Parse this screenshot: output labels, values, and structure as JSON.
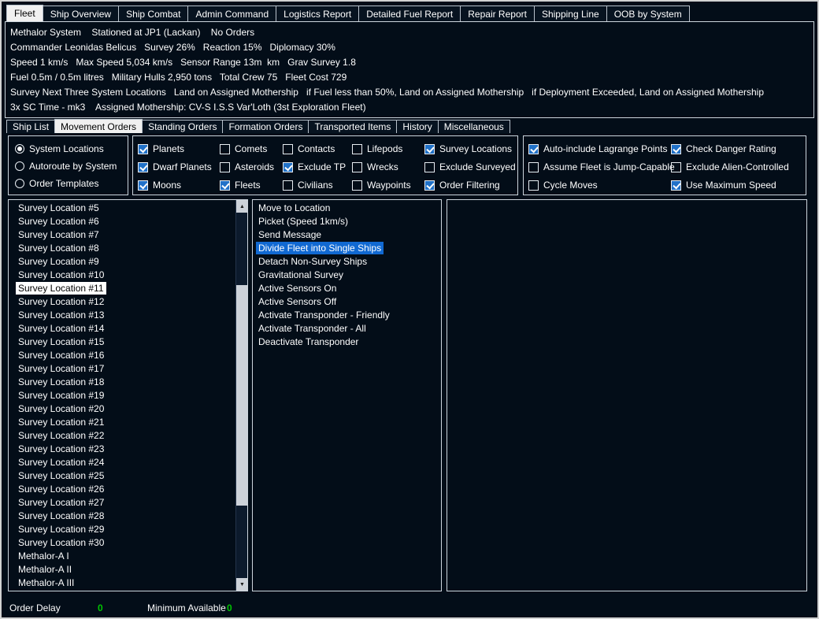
{
  "window": {
    "bg": "#030d18",
    "selection_blue": "#1169d2",
    "selection_white": "#ffffff",
    "value_green": "#00c600",
    "checkbox_blue": "#2071c8"
  },
  "tabs_main": {
    "items": [
      "Fleet",
      "Ship Overview",
      "Ship Combat",
      "Admin Command",
      "Logistics Report",
      "Detailed Fuel Report",
      "Repair Report",
      "Shipping Line",
      "OOB by System"
    ],
    "selected_index": 0
  },
  "fleet_info": {
    "lines": [
      "Methalor System    Stationed at JP1 (Lackan)    No Orders",
      "Commander Leonidas Belicus   Survey 26%   Reaction 15%   Diplomacy 30%",
      "Speed 1 km/s   Max Speed 5,034 km/s   Sensor Range 13m  km   Grav Survey 1.8",
      "Fuel 0.5m / 0.5m litres   Military Hulls 2,950 tons   Total Crew 75   Fleet Cost 729",
      "Survey Next Three System Locations   Land on Assigned Mothership   if Fuel less than 50%, Land on Assigned Mothership   if Deployment Exceeded, Land on Assigned Mothership",
      "3x SC Time - mk3    Assigned Mothership: CV-S I.S.S Var'Loth (3st Exploration Fleet)"
    ]
  },
  "tabs_sub": {
    "items": [
      "Ship List",
      "Movement Orders",
      "Standing Orders",
      "Formation Orders",
      "Transported Items",
      "History",
      "Miscellaneous"
    ],
    "selected_index": 1
  },
  "view_modes": {
    "items": [
      {
        "label": "System Locations",
        "selected": true
      },
      {
        "label": "Autoroute by System",
        "selected": false
      },
      {
        "label": "Order Templates",
        "selected": false
      }
    ]
  },
  "filters": {
    "columns": [
      [
        {
          "label": "Planets",
          "checked": true
        },
        {
          "label": "Dwarf Planets",
          "checked": true
        },
        {
          "label": "Moons",
          "checked": true
        }
      ],
      [
        {
          "label": "Comets",
          "checked": false
        },
        {
          "label": "Asteroids",
          "checked": false
        },
        {
          "label": "Fleets",
          "checked": true
        }
      ],
      [
        {
          "label": "Contacts",
          "checked": false
        },
        {
          "label": "Exclude TP",
          "checked": true
        },
        {
          "label": "Civilians",
          "checked": false
        }
      ],
      [
        {
          "label": "Lifepods",
          "checked": false
        },
        {
          "label": "Wrecks",
          "checked": false
        },
        {
          "label": "Waypoints",
          "checked": false
        }
      ],
      [
        {
          "label": "Survey Locations",
          "checked": true
        },
        {
          "label": "Exclude Surveyed",
          "checked": false
        },
        {
          "label": "Order Filtering",
          "checked": true
        }
      ]
    ]
  },
  "options": {
    "columns": [
      [
        {
          "label": "Auto-include Lagrange Points",
          "checked": true
        },
        {
          "label": "Assume Fleet is Jump-Capable",
          "checked": false
        },
        {
          "label": "Cycle Moves",
          "checked": false
        }
      ],
      [
        {
          "label": "Check Danger Rating",
          "checked": true
        },
        {
          "label": "Exclude Alien-Controlled",
          "checked": false
        },
        {
          "label": "Use Maximum Speed",
          "checked": true
        }
      ]
    ]
  },
  "locations_list": {
    "selected_index": 6,
    "items": [
      "Survey Location #5",
      "Survey Location #6",
      "Survey Location #7",
      "Survey Location #8",
      "Survey Location #9",
      "Survey Location #10",
      "Survey Location #11",
      "Survey Location #12",
      "Survey Location #13",
      "Survey Location #14",
      "Survey Location #15",
      "Survey Location #16",
      "Survey Location #17",
      "Survey Location #18",
      "Survey Location #19",
      "Survey Location #20",
      "Survey Location #21",
      "Survey Location #22",
      "Survey Location #23",
      "Survey Location #24",
      "Survey Location #25",
      "Survey Location #26",
      "Survey Location #27",
      "Survey Location #28",
      "Survey Location #29",
      "Survey Location #30",
      "Methalor-A I",
      "Methalor-A II",
      "Methalor-A III"
    ]
  },
  "actions_list": {
    "selected_index": 3,
    "items": [
      "Move to Location",
      "Picket (Speed 1km/s)",
      "Send Message",
      "Divide Fleet into Single Ships",
      "Detach Non-Survey Ships",
      "Gravitational Survey",
      "Active Sensors On",
      "Active Sensors Off",
      "Activate Transponder - Friendly",
      "Activate Transponder - All",
      "Deactivate Transponder"
    ]
  },
  "orders_list": {
    "selected_index": -1,
    "items": []
  },
  "scrollbar": {
    "up_icon": "▲",
    "down_icon": "▼"
  },
  "footer": {
    "order_delay_label": "Order Delay",
    "order_delay_value": "0",
    "minimum_available_label": "Minimum Available",
    "minimum_available_value": "0"
  }
}
